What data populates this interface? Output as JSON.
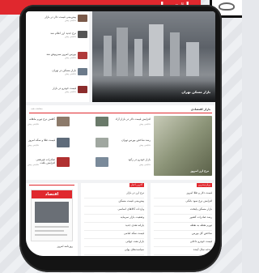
{
  "banner": {
    "title": "اقتصاد"
  },
  "top_section": {
    "list_items": [
      {
        "title": "پیش‌بینی قیمت دلار در بازار",
        "time": "دقایقی پیش"
      },
      {
        "title": "نرخ جدید ارز اعلام شد",
        "time": "دقایقی پیش"
      },
      {
        "title": "بورس امروز سبزپوش شد",
        "time": "دقایقی پیش"
      },
      {
        "title": "بازار مسکن در تهران",
        "time": "دقایقی پیش"
      },
      {
        "title": "قیمت خودرو در بازار",
        "time": "دقایقی پیش"
      }
    ],
    "hero_caption": "بازار مسکن تهران"
  },
  "economy_section": {
    "header_right": "بازار اقتصادی",
    "header_left": "مشاهده همه",
    "hero_caption": "نرخ ارز امروز",
    "items": [
      {
        "title": "افزایش قیمت دلار در بازار آزاد",
        "time": "دقایقی پیش"
      },
      {
        "title": "کاهش نرخ تورم ماهانه",
        "time": "دقایقی پیش"
      },
      {
        "title": "رشد شاخص بورس تهران",
        "time": "دقایقی پیش"
      },
      {
        "title": "قیمت طلا و سکه امروز",
        "time": "دقایقی پیش"
      },
      {
        "title": "بازار خودرو در رکود",
        "time": "دقایقی پیش"
      },
      {
        "title": "صادرات غیرنفتی افزایش یافت",
        "time": "دقایقی پیش"
      }
    ]
  },
  "bottom_section": {
    "col1_tag": "پربازدیدترین",
    "col2_tag": "آخرین اخبار",
    "newspaper_title": "اقتصاد",
    "newspaper_caption": "روزنامه امروز",
    "col1_items": [
      "قیمت دلار و طلا امروز",
      "افزایش نرخ سود بانکی",
      "بازار مسکن پایتخت",
      "رشد صادرات کشور",
      "تورم نقطه به نقطه",
      "شاخص کل بورس",
      "قیمت خودرو داخلی",
      "بودجه سال آینده"
    ],
    "col2_items": [
      "نرخ ارز در بازار",
      "پیش‌بینی قیمت مسکن",
      "واردات کالاهای اساسی",
      "وضعیت بازار سرمایه",
      "یارانه نقدی جدید",
      "قیمت سکه امامی",
      "بازار نفت جهانی",
      "سیاست‌های پولی"
    ]
  }
}
